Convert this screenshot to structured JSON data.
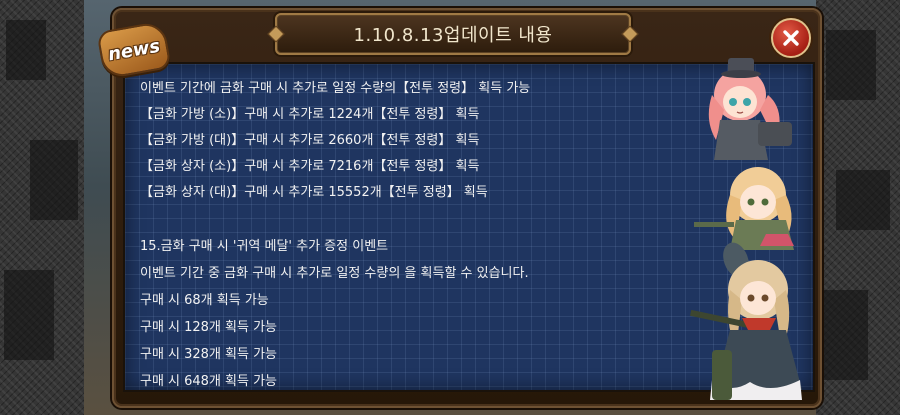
{
  "popup": {
    "badge_label": "news",
    "title": "1.10.8.13업데이트 내용",
    "lines": [
      "이벤트 기간에 금화 구매 시 추가로 일정 수량의【전투 정령】 획득 가능",
      "【금화 가방 (소)】구매 시 추가로 1224개【전투 정령】 획득",
      "【금화 가방 (대)】구매 시 추가로 2660개【전투 정령】 획득",
      "【금화 상자 (소)】구매 시 추가로 7216개【전투 정령】 획득",
      "【금화 상자 (대)】구매 시 추가로 15552개【전투 정령】 획득",
      "",
      "15.금화 구매 시 '귀역 메달' 추가 증정 이벤트",
      "이벤트 기간 중 금화 구매 시 추가로 일정 수량의 을 획득할 수 있습니다.",
      " 구매 시  68개 획득 가능",
      " 구매 시  128개 획득 가능",
      " 구매 시  328개 획득 가능",
      " 구매 시  648개 획득 가능"
    ]
  },
  "icons": {
    "close": "close-x-icon",
    "badge": "news-badge-icon"
  },
  "colors": {
    "panel_bg": "#1f3560",
    "frame": "#3a2616",
    "close": "#c0392b",
    "text": "#f2f2f2"
  }
}
